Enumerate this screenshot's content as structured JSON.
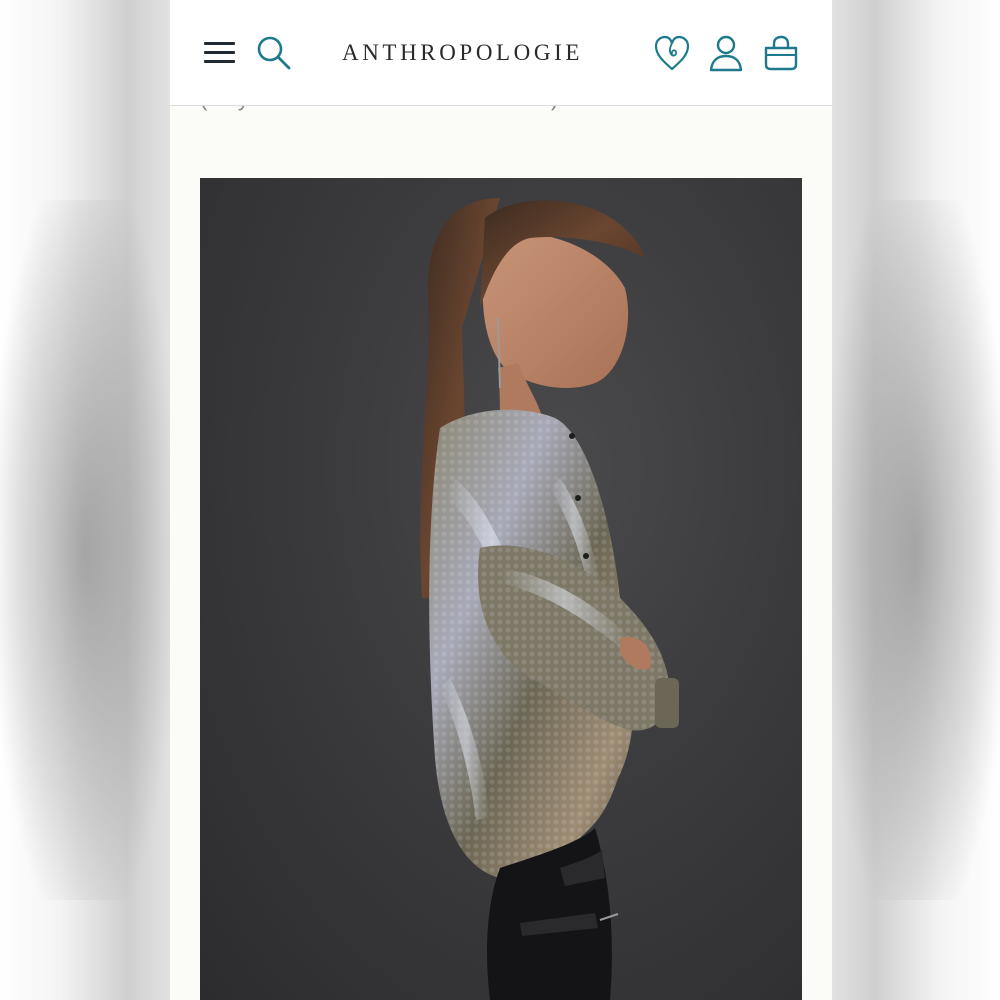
{
  "header": {
    "brand": "ANTHROPOLOGIE",
    "menu_icon": "hamburger-menu-icon",
    "search_icon": "search-icon",
    "wishlist_icon": "heart-icon",
    "account_icon": "user-icon",
    "bag_icon": "shopping-bag-icon",
    "icon_color": "#1c7a8c"
  },
  "product": {
    "duty_note": "(duty and tax calculated at checkout)",
    "image_description_icon": "product-photo"
  },
  "colors": {
    "accent": "#1c7a8c",
    "text_dark": "#2a2a2a",
    "muted": "#8a8a8a",
    "image_bg": "#3a3a3c"
  }
}
